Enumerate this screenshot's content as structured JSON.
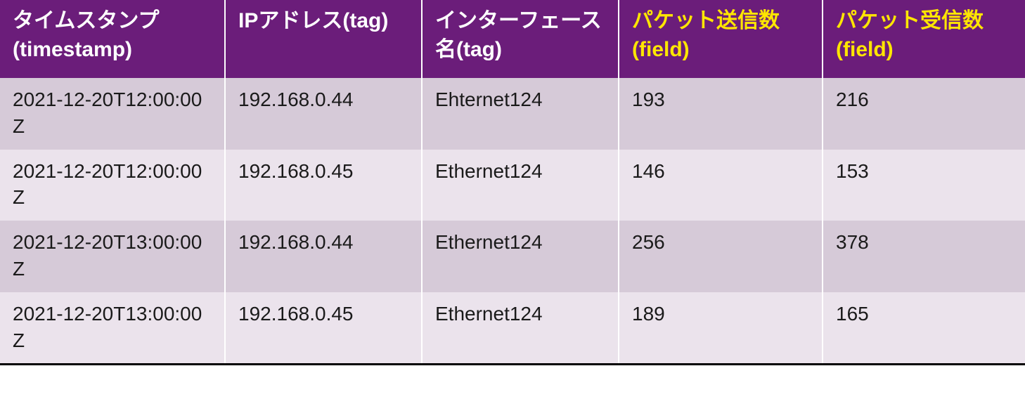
{
  "table": {
    "headers": [
      {
        "label": "タイムスタンプ(timestamp)",
        "kind": "normal"
      },
      {
        "label": "IPアドレス(tag)",
        "kind": "normal"
      },
      {
        "label": "インターフェース名(tag)",
        "kind": "normal"
      },
      {
        "label": "パケット送信数(field)",
        "kind": "field"
      },
      {
        "label": "パケット受信数(field)",
        "kind": "field"
      }
    ],
    "rows": [
      {
        "timestamp": "2021-12-20T12:00:00Z",
        "ip": "192.168.0.44",
        "iface": "Ehternet124",
        "sent": "193",
        "recv": "216"
      },
      {
        "timestamp": "2021-12-20T12:00:00Z",
        "ip": "192.168.0.45",
        "iface": "Ethernet124",
        "sent": "146",
        "recv": "153"
      },
      {
        "timestamp": "2021-12-20T13:00:00Z",
        "ip": "192.168.0.44",
        "iface": "Ethernet124",
        "sent": "256",
        "recv": "378"
      },
      {
        "timestamp": "2021-12-20T13:00:00Z",
        "ip": "192.168.0.45",
        "iface": "Ethernet124",
        "sent": "189",
        "recv": "165"
      }
    ]
  }
}
